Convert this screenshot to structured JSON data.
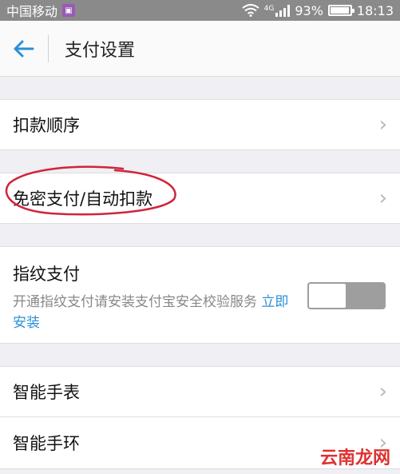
{
  "status_bar": {
    "carrier": "中国移动",
    "network": "4G",
    "battery": "93%",
    "time": "18:13"
  },
  "toolbar": {
    "title": "支付设置"
  },
  "rows": {
    "deduction_order": "扣款顺序",
    "password_free": "免密支付/自动扣款",
    "smart_watch": "智能手表",
    "smart_band": "智能手环"
  },
  "fingerprint": {
    "title": "指纹支付",
    "description": "开通指纹支付请安装支付宝安全校验服务",
    "link": "立即安装",
    "enabled": false
  },
  "watermark": "云南龙网",
  "colors": {
    "accent": "#2a8fd8",
    "annotation": "#d0243a",
    "watermark": "#e03030"
  }
}
